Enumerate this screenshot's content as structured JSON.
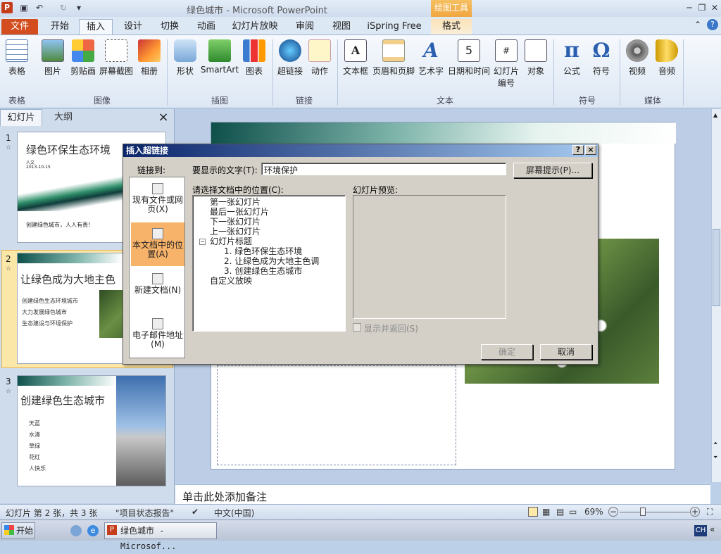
{
  "window": {
    "title": "绿色城市 - Microsoft PowerPoint",
    "context_tab": "绘图工具",
    "app_icon": "P"
  },
  "tabs": [
    "文件",
    "开始",
    "插入",
    "设计",
    "切换",
    "动画",
    "幻灯片放映",
    "审阅",
    "视图",
    "iSpring Free",
    "格式"
  ],
  "ribbon": {
    "buttons": [
      "表格",
      "图片",
      "剪贴画",
      "屏幕截图",
      "相册",
      "形状",
      "SmartArt",
      "图表",
      "超链接",
      "动作",
      "文本框",
      "页眉和页脚",
      "艺术字",
      "日期和时间",
      "幻灯片\n编号",
      "对象",
      "公式",
      "符号",
      "视频",
      "音频"
    ],
    "groups": [
      "表格",
      "图像",
      "插图",
      "链接",
      "文本",
      "符号",
      "媒体"
    ]
  },
  "panel": {
    "tabs": [
      "幻灯片",
      "大纲"
    ],
    "close": "×",
    "slides": [
      {
        "num": "1",
        "title": "绿色环保生态环境",
        "sub1": "人文",
        "sub2": "2013-10-15",
        "bottom": "创建绿色城市，人人有责！"
      },
      {
        "num": "2",
        "title": "让绿色成为大地主色",
        "bullets": [
          "创建绿色生态环境城市",
          "大力发展绿色城市",
          "生态建设与环境保护"
        ]
      },
      {
        "num": "3",
        "title": "创建绿色生态城市",
        "bullets": [
          "天蓝",
          "水清",
          "草绿",
          "花红",
          "人快乐"
        ]
      }
    ]
  },
  "notes": "单击此处添加备注",
  "status": {
    "slide_info": "幻灯片 第 2 张，共 3 张",
    "theme": "\"项目状态报告\"",
    "language": "中文(中国)",
    "zoom": "69%",
    "zoom_level": 0.69
  },
  "taskbar": {
    "start": "开始",
    "app": "绿色城市 - Microsof...",
    "ime": "CH"
  },
  "dialog": {
    "title": "插入超链接",
    "help": "?",
    "close": "×",
    "link_to": "链接到:",
    "link_options": [
      "现有文件或网页(X)",
      "本文档中的位置(A)",
      "新建文档(N)",
      "电子邮件地址(M)"
    ],
    "display_text_label": "要显示的文字(T):",
    "display_text_value": "环境保护",
    "screentip_button": "屏幕提示(P)...",
    "select_place_label": "请选择文档中的位置(C):",
    "tree": [
      "第一张幻灯片",
      "最后一张幻灯片",
      "下一张幻灯片",
      "上一张幻灯片",
      "幻灯片标题",
      "1. 绿色环保生态环境",
      "2. 让绿色成为大地主色调",
      "3. 创建绿色生态城市",
      "自定义放映"
    ],
    "preview_label": "幻灯片预览:",
    "show_return": "显示并返回(S)",
    "ok": "确定",
    "cancel": "取消"
  }
}
